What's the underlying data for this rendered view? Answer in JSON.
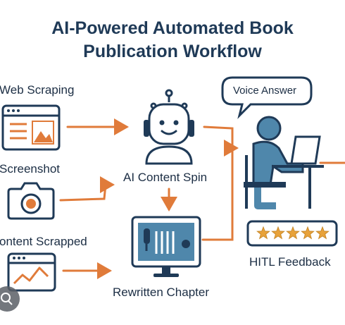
{
  "title": {
    "line1": "AI-Powered Automated Book",
    "line2": "Publication Workflow"
  },
  "nodes": {
    "web_scraping": "Web Scraping",
    "screenshot": "Screenshot",
    "content_scrapped": "ontent Scrapped",
    "ai_content_spin": "AI Content Spin",
    "rewritten_chapter": "Rewritten Chapter",
    "voice_answer": "Voice Answer",
    "hitl_feedback": "HITL Feedback"
  },
  "rating": {
    "stars": 5
  },
  "colors": {
    "navy": "#1f3a57",
    "arrow": "#e07b3a",
    "person": "#4f87ab",
    "star": "#e8a23a"
  }
}
